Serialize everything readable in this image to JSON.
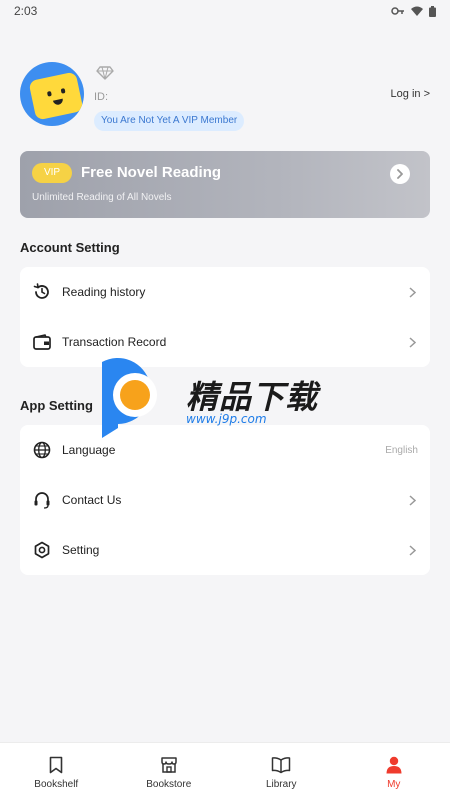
{
  "status_bar": {
    "time": "2:03"
  },
  "profile": {
    "id_label": "ID:",
    "vip_status": "You Are Not Yet A VIP Member",
    "login_label": "Log in >"
  },
  "vip_banner": {
    "tag": "VIP",
    "title": "Free Novel Reading",
    "subtitle": "Unlimited Reading of All Novels",
    "accent_color": "#f6d245"
  },
  "account_setting": {
    "title": "Account Setting",
    "items": [
      {
        "label": "Reading history",
        "icon": "history-icon"
      },
      {
        "label": "Transaction Record",
        "icon": "wallet-icon"
      }
    ]
  },
  "app_setting": {
    "title": "App Setting",
    "items": [
      {
        "label": "Language",
        "value": "English",
        "icon": "globe-icon"
      },
      {
        "label": "Contact Us",
        "icon": "headset-icon"
      },
      {
        "label": "Setting",
        "icon": "settings-icon"
      }
    ]
  },
  "watermark": {
    "text": "精品下载",
    "url": "www.j9p.com"
  },
  "bottom_nav": {
    "active_color": "#ef3b2d",
    "items": [
      {
        "label": "Bookshelf",
        "icon": "bookmark-icon"
      },
      {
        "label": "Bookstore",
        "icon": "store-icon"
      },
      {
        "label": "Library",
        "icon": "book-icon"
      },
      {
        "label": "My",
        "icon": "person-icon"
      }
    ]
  }
}
